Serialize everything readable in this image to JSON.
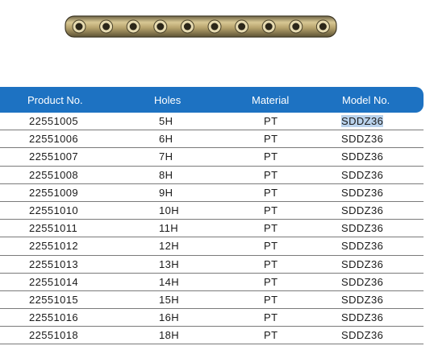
{
  "image": {
    "icon": "bone-plate-image",
    "hole_count": 10
  },
  "table": {
    "headers": [
      "Product No.",
      "Holes",
      "Material",
      "Model No."
    ],
    "rows": [
      [
        "22551005",
        "5H",
        "PT",
        "SDDZ36"
      ],
      [
        "22551006",
        "6H",
        "PT",
        "SDDZ36"
      ],
      [
        "22551007",
        "7H",
        "PT",
        "SDDZ36"
      ],
      [
        "22551008",
        "8H",
        "PT",
        "SDDZ36"
      ],
      [
        "22551009",
        "9H",
        "PT",
        "SDDZ36"
      ],
      [
        "22551010",
        "10H",
        "PT",
        "SDDZ36"
      ],
      [
        "22551011",
        "11H",
        "PT",
        "SDDZ36"
      ],
      [
        "22551012",
        "12H",
        "PT",
        "SDDZ36"
      ],
      [
        "22551013",
        "13H",
        "PT",
        "SDDZ36"
      ],
      [
        "22551014",
        "14H",
        "PT",
        "SDDZ36"
      ],
      [
        "22551015",
        "15H",
        "PT",
        "SDDZ36"
      ],
      [
        "22551016",
        "16H",
        "PT",
        "SDDZ36"
      ],
      [
        "22551018",
        "18H",
        "PT",
        "SDDZ36"
      ]
    ]
  },
  "colors": {
    "header_bg": "#1d72c2",
    "header_text": "#ffffff",
    "selection": "#b9d2ec",
    "plate": "#b8a46e"
  }
}
